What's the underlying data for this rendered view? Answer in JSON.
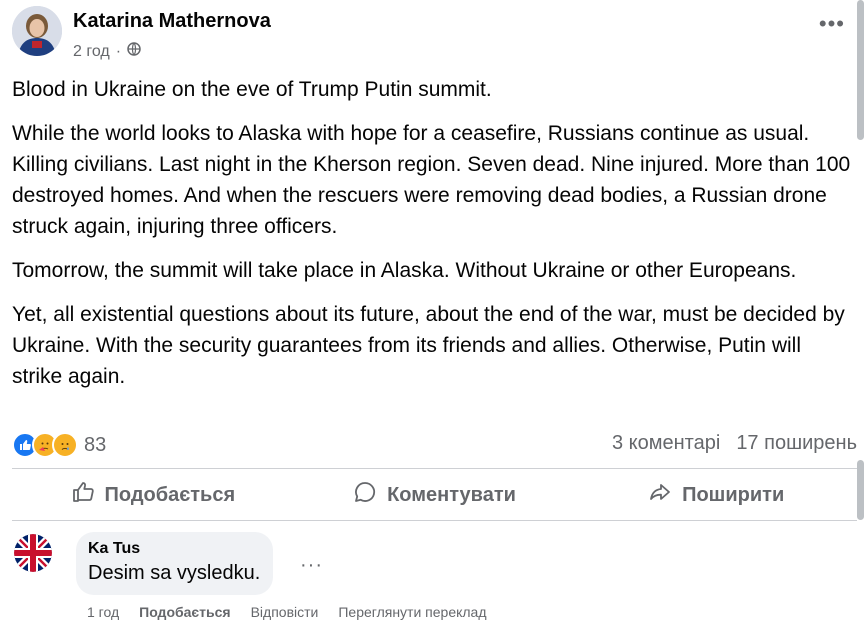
{
  "post": {
    "author": "Katarina Mathernova",
    "time": "2 год",
    "privacy_icon": "globe-icon",
    "more_icon": "more-horizontal-icon",
    "paragraphs": [
      "Blood in Ukraine on the eve of Trump Putin summit.",
      "While the world looks to Alaska with hope for a ceasefire, Russians continue as usual. Killing civilians. Last night in the Kherson region. Seven dead. Nine injured. More than 100 destroyed homes. And when the rescuers were removing dead bodies, a Russian drone struck again, injuring three officers.",
      "Tomorrow, the summit will take place in Alaska. Without Ukraine or other Europeans.",
      "Yet, all existential questions about its future, about the end of the war, must be decided by Ukraine. With the security guarantees from its friends and allies. Otherwise, Putin will strike again."
    ]
  },
  "reactions": {
    "count": "83",
    "types": [
      "like",
      "care",
      "sad"
    ],
    "comments_count": "3 коментарі",
    "shares_count": "17 поширень"
  },
  "actions": {
    "like": "Подобається",
    "comment": "Коментувати",
    "share": "Поширити"
  },
  "comment": {
    "author": "Ka Tus",
    "text": "Desim sa vysledku.",
    "time": "1 год",
    "like": "Подобається",
    "reply": "Відповісти",
    "translate": "Переглянути переклад"
  },
  "colors": {
    "text": "#050505",
    "secondary": "#65676b",
    "like_blue": "#1877f2",
    "bubble": "#f0f2f5"
  }
}
